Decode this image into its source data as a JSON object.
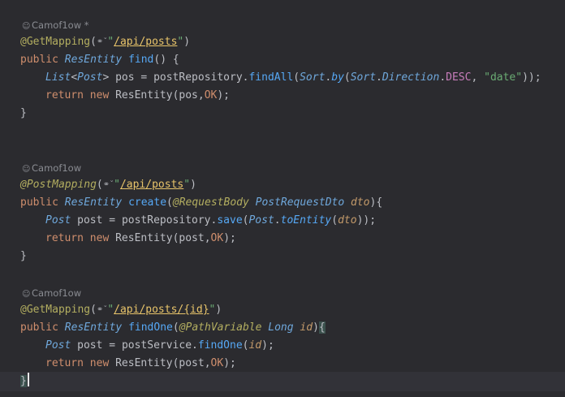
{
  "annotations": {
    "author1": "Camof1ow *",
    "author2": "Camof1ow",
    "author3": "Camof1ow"
  },
  "icons": {
    "author": "person-icon",
    "endpoint": "globe-chevron-icon"
  },
  "code": {
    "find": {
      "ann": "@GetMapping",
      "url": "/api/posts",
      "kw_public": "public",
      "ret": "ResEntity",
      "name": "find",
      "sig_rest": "() {",
      "l1_type": "List",
      "l1_generic": "Post",
      "l1_var": " pos = ",
      "l1_repo": "postRepository",
      "l1_method": "findAll",
      "l1_sort": "Sort",
      "l1_by": "by",
      "l1_sort2": "Sort",
      "l1_direction": "Direction",
      "l1_desc": "DESC",
      "l1_date": "\"date\"",
      "l2_return": "return",
      "l2_new": "new",
      "l2_cls": "ResEntity",
      "l2_args": "(pos,",
      "l2_ok": "OK",
      "close": "}"
    },
    "create": {
      "ann": "@PostMapping",
      "url": "/api/posts",
      "kw_public": "public",
      "ret": "ResEntity",
      "name": "create",
      "param_ann": "@RequestBody",
      "param_type": "PostRequestDto",
      "param_name": "dto",
      "l1_type": "Post",
      "l1_var": " post = ",
      "l1_repo": "postRepository",
      "l1_method": "save",
      "l1_cls": "Post",
      "l1_static": "toEntity",
      "l1_arg": "dto",
      "l2_return": "return",
      "l2_new": "new",
      "l2_cls": "ResEntity",
      "l2_args": "(post,",
      "l2_ok": "OK",
      "close": "}"
    },
    "findOne": {
      "ann": "@GetMapping",
      "url": "/api/posts/{id}",
      "kw_public": "public",
      "ret": "ResEntity",
      "name": "findOne",
      "param_ann": "@PathVariable",
      "param_type": "Long",
      "param_name": "id",
      "l1_type": "Post",
      "l1_var": " post = ",
      "l1_svc": "postService",
      "l1_method": "findOne",
      "l1_arg": "id",
      "l2_return": "return",
      "l2_new": "new",
      "l2_cls": "ResEntity",
      "l2_args": "(post,",
      "l2_ok": "OK",
      "close": "}"
    }
  },
  "colors": {
    "background": "#2b2b2f",
    "annotation": "#b3ae60",
    "keyword": "#cf8e6d",
    "class": "#6fa8dc",
    "function": "#56a8f5",
    "string": "#6aab73",
    "constant": "#c77dbb"
  }
}
